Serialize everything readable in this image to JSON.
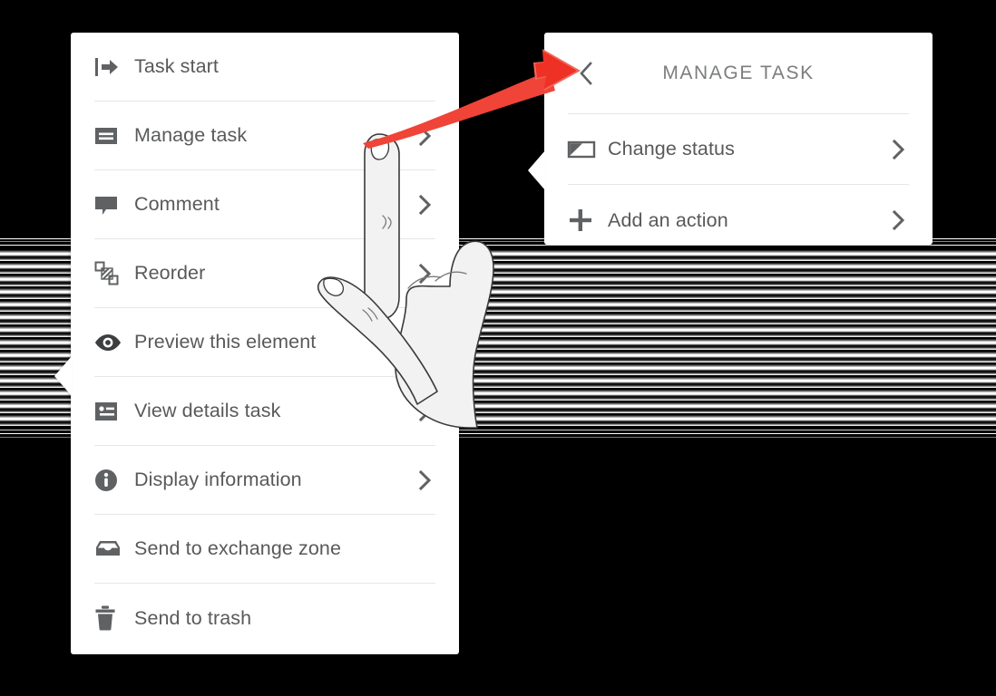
{
  "context_menu": {
    "name": "element-context-menu",
    "items": [
      {
        "label": "Task start",
        "icon": "task-start-icon",
        "chevron": false
      },
      {
        "label": "Manage task",
        "icon": "manage-task-icon",
        "chevron": true
      },
      {
        "label": "Comment",
        "icon": "comment-icon",
        "chevron": true
      },
      {
        "label": "Reorder",
        "icon": "reorder-icon",
        "chevron": true
      },
      {
        "label": "Preview this element",
        "icon": "eye-icon",
        "chevron": false
      },
      {
        "label": "View details task",
        "icon": "details-card-icon",
        "chevron": true
      },
      {
        "label": "Display information",
        "icon": "info-circle-icon",
        "chevron": true
      },
      {
        "label": "Send to exchange zone",
        "icon": "inbox-tray-icon",
        "chevron": false
      },
      {
        "label": "Send to trash",
        "icon": "trash-icon",
        "chevron": false
      }
    ]
  },
  "submenu": {
    "title": "MANAGE TASK",
    "back_icon": "chevron-left-icon",
    "items": [
      {
        "label": "Change status",
        "icon": "status-flag-icon",
        "chevron": true
      },
      {
        "label": "Add an action",
        "icon": "plus-icon",
        "chevron": true
      }
    ]
  },
  "annotation": {
    "arrow_name": "red-flow-arrow",
    "arrow_color": "#ee3124",
    "arrow_color_light": "#f0695c"
  },
  "illustration": {
    "name": "pointing-hand-illustration",
    "fill": "#f2f2f2",
    "stroke": "#3d3d3d"
  },
  "theme": {
    "panel_background": "#ffffff",
    "page_background": "#000000",
    "text_color": "#58595b",
    "icon_color": "#5f6163",
    "divider_color": "#e6e6e6",
    "title_color": "#7c7d7f"
  }
}
